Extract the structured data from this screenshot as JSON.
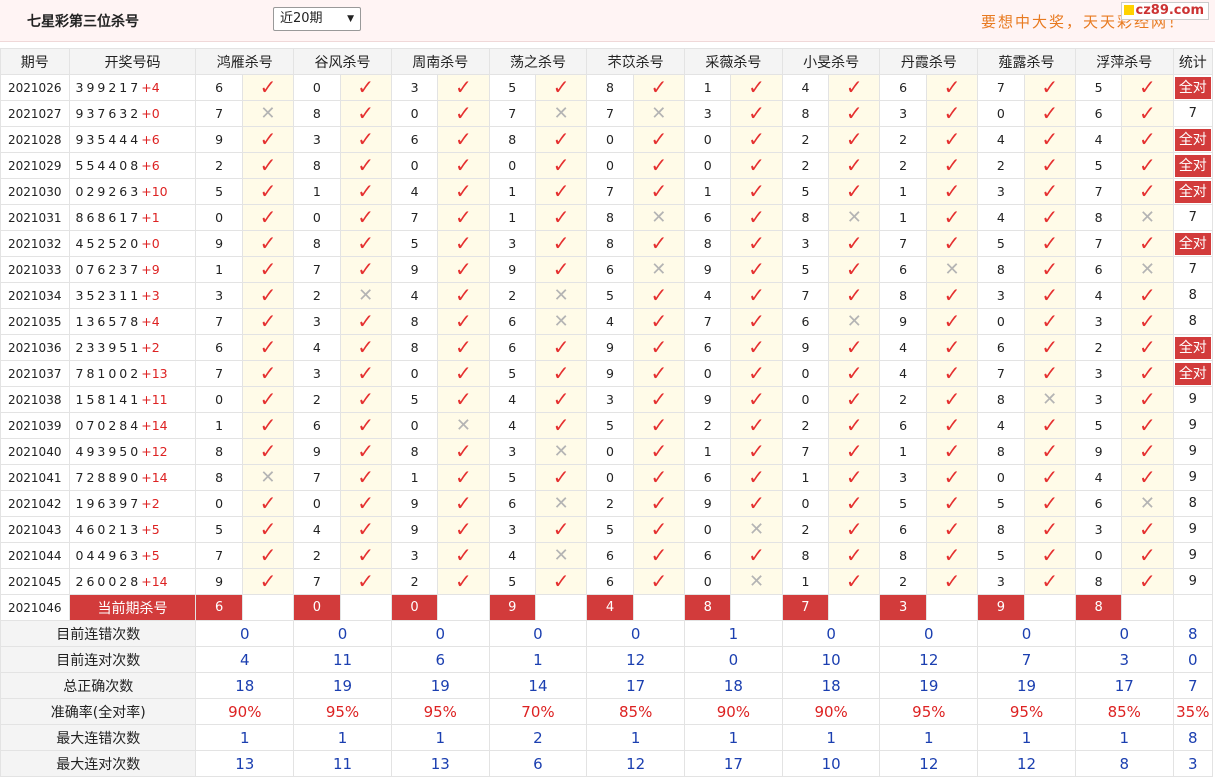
{
  "header": {
    "title": "七星彩第三位杀号",
    "range_select": "近20期",
    "slogan": "要想中大奖，天天彩经网！",
    "logo": "cz89.com"
  },
  "columns": {
    "period": "期号",
    "draw": "开奖号码",
    "experts": [
      "鸿雁杀号",
      "谷风杀号",
      "周南杀号",
      "荡之杀号",
      "芣苡杀号",
      "采薇杀号",
      "小旻杀号",
      "丹霞杀号",
      "薤露杀号",
      "浮萍杀号"
    ],
    "stat": "统计"
  },
  "rows": [
    {
      "period": "2021026",
      "digits": "399217",
      "plus": "+4",
      "kills": [
        6,
        0,
        3,
        5,
        8,
        1,
        4,
        6,
        7,
        5
      ],
      "hits": [
        1,
        1,
        1,
        1,
        1,
        1,
        1,
        1,
        1,
        1
      ],
      "stat": "全对"
    },
    {
      "period": "2021027",
      "digits": "937632",
      "plus": "+0",
      "kills": [
        7,
        8,
        0,
        7,
        7,
        3,
        8,
        3,
        0,
        6
      ],
      "hits": [
        0,
        1,
        1,
        0,
        0,
        1,
        1,
        1,
        1,
        1
      ],
      "stat": "7"
    },
    {
      "period": "2021028",
      "digits": "935444",
      "plus": "+6",
      "kills": [
        9,
        3,
        6,
        8,
        0,
        0,
        2,
        2,
        4,
        4
      ],
      "hits": [
        1,
        1,
        1,
        1,
        1,
        1,
        1,
        1,
        1,
        1
      ],
      "stat": "全对"
    },
    {
      "period": "2021029",
      "digits": "554408",
      "plus": "+6",
      "kills": [
        2,
        8,
        0,
        0,
        0,
        0,
        2,
        2,
        2,
        5
      ],
      "hits": [
        1,
        1,
        1,
        1,
        1,
        1,
        1,
        1,
        1,
        1
      ],
      "stat": "全对"
    },
    {
      "period": "2021030",
      "digits": "029263",
      "plus": "+10",
      "kills": [
        5,
        1,
        4,
        1,
        7,
        1,
        5,
        1,
        3,
        7
      ],
      "hits": [
        1,
        1,
        1,
        1,
        1,
        1,
        1,
        1,
        1,
        1
      ],
      "stat": "全对"
    },
    {
      "period": "2021031",
      "digits": "868617",
      "plus": "+1",
      "kills": [
        0,
        0,
        7,
        1,
        8,
        6,
        8,
        1,
        4,
        8
      ],
      "hits": [
        1,
        1,
        1,
        1,
        0,
        1,
        0,
        1,
        1,
        0
      ],
      "stat": "7"
    },
    {
      "period": "2021032",
      "digits": "452520",
      "plus": "+0",
      "kills": [
        9,
        8,
        5,
        3,
        8,
        8,
        3,
        7,
        5,
        7
      ],
      "hits": [
        1,
        1,
        1,
        1,
        1,
        1,
        1,
        1,
        1,
        1
      ],
      "stat": "全对"
    },
    {
      "period": "2021033",
      "digits": "076237",
      "plus": "+9",
      "kills": [
        1,
        7,
        9,
        9,
        6,
        9,
        5,
        6,
        8,
        6
      ],
      "hits": [
        1,
        1,
        1,
        1,
        0,
        1,
        1,
        0,
        1,
        0
      ],
      "stat": "7"
    },
    {
      "period": "2021034",
      "digits": "352311",
      "plus": "+3",
      "kills": [
        3,
        2,
        4,
        2,
        5,
        4,
        7,
        8,
        3,
        4
      ],
      "hits": [
        1,
        0,
        1,
        0,
        1,
        1,
        1,
        1,
        1,
        1
      ],
      "stat": "8"
    },
    {
      "period": "2021035",
      "digits": "136578",
      "plus": "+4",
      "kills": [
        7,
        3,
        8,
        6,
        4,
        7,
        6,
        9,
        0,
        3
      ],
      "hits": [
        1,
        1,
        1,
        0,
        1,
        1,
        0,
        1,
        1,
        1
      ],
      "stat": "8"
    },
    {
      "period": "2021036",
      "digits": "233951",
      "plus": "+2",
      "kills": [
        6,
        4,
        8,
        6,
        9,
        6,
        9,
        4,
        6,
        2
      ],
      "hits": [
        1,
        1,
        1,
        1,
        1,
        1,
        1,
        1,
        1,
        1
      ],
      "stat": "全对"
    },
    {
      "period": "2021037",
      "digits": "781002",
      "plus": "+13",
      "kills": [
        7,
        3,
        0,
        5,
        9,
        0,
        0,
        4,
        7,
        3
      ],
      "hits": [
        1,
        1,
        1,
        1,
        1,
        1,
        1,
        1,
        1,
        1
      ],
      "stat": "全对"
    },
    {
      "period": "2021038",
      "digits": "158141",
      "plus": "+11",
      "kills": [
        0,
        2,
        5,
        4,
        3,
        9,
        0,
        2,
        8,
        3
      ],
      "hits": [
        1,
        1,
        1,
        1,
        1,
        1,
        1,
        1,
        0,
        1
      ],
      "stat": "9"
    },
    {
      "period": "2021039",
      "digits": "070284",
      "plus": "+14",
      "kills": [
        1,
        6,
        0,
        4,
        5,
        2,
        2,
        6,
        4,
        5
      ],
      "hits": [
        1,
        1,
        0,
        1,
        1,
        1,
        1,
        1,
        1,
        1
      ],
      "stat": "9"
    },
    {
      "period": "2021040",
      "digits": "493950",
      "plus": "+12",
      "kills": [
        8,
        9,
        8,
        3,
        0,
        1,
        7,
        1,
        8,
        9
      ],
      "hits": [
        1,
        1,
        1,
        0,
        1,
        1,
        1,
        1,
        1,
        1
      ],
      "stat": "9"
    },
    {
      "period": "2021041",
      "digits": "728890",
      "plus": "+14",
      "kills": [
        8,
        7,
        1,
        5,
        0,
        6,
        1,
        3,
        0,
        4
      ],
      "hits": [
        0,
        1,
        1,
        1,
        1,
        1,
        1,
        1,
        1,
        1
      ],
      "stat": "9"
    },
    {
      "period": "2021042",
      "digits": "196397",
      "plus": "+2",
      "kills": [
        0,
        0,
        9,
        6,
        2,
        9,
        0,
        5,
        5,
        6
      ],
      "hits": [
        1,
        1,
        1,
        0,
        1,
        1,
        1,
        1,
        1,
        0
      ],
      "stat": "8"
    },
    {
      "period": "2021043",
      "digits": "460213",
      "plus": "+5",
      "kills": [
        5,
        4,
        9,
        3,
        5,
        0,
        2,
        6,
        8,
        3
      ],
      "hits": [
        1,
        1,
        1,
        1,
        1,
        0,
        1,
        1,
        1,
        1
      ],
      "stat": "9"
    },
    {
      "period": "2021044",
      "digits": "044963",
      "plus": "+5",
      "kills": [
        7,
        2,
        3,
        4,
        6,
        6,
        8,
        8,
        5,
        0
      ],
      "hits": [
        1,
        1,
        1,
        0,
        1,
        1,
        1,
        1,
        1,
        1
      ],
      "stat": "9"
    },
    {
      "period": "2021045",
      "digits": "260028",
      "plus": "+14",
      "kills": [
        9,
        7,
        2,
        5,
        6,
        0,
        1,
        2,
        3,
        8
      ],
      "hits": [
        1,
        1,
        1,
        1,
        1,
        0,
        1,
        1,
        1,
        1
      ],
      "stat": "9"
    }
  ],
  "current": {
    "period": "2021046",
    "label": "当前期杀号",
    "kills": [
      6,
      0,
      0,
      9,
      4,
      8,
      7,
      3,
      9,
      8
    ]
  },
  "footer": [
    {
      "label": "目前连错次数",
      "values": [
        "0",
        "0",
        "0",
        "0",
        "0",
        "1",
        "0",
        "0",
        "0",
        "0"
      ],
      "stat": "8",
      "color": "blue"
    },
    {
      "label": "目前连对次数",
      "values": [
        "4",
        "11",
        "6",
        "1",
        "12",
        "0",
        "10",
        "12",
        "7",
        "3"
      ],
      "stat": "0",
      "color": "blue"
    },
    {
      "label": "总正确次数",
      "values": [
        "18",
        "19",
        "19",
        "14",
        "17",
        "18",
        "18",
        "19",
        "19",
        "17"
      ],
      "stat": "7",
      "color": "blue"
    },
    {
      "label": "准确率(全对率)",
      "values": [
        "90%",
        "95%",
        "95%",
        "70%",
        "85%",
        "90%",
        "90%",
        "95%",
        "95%",
        "85%"
      ],
      "stat": "35%",
      "color": "red"
    },
    {
      "label": "最大连错次数",
      "values": [
        "1",
        "1",
        "1",
        "2",
        "1",
        "1",
        "1",
        "1",
        "1",
        "1"
      ],
      "stat": "8",
      "color": "blue"
    },
    {
      "label": "最大连对次数",
      "values": [
        "13",
        "11",
        "13",
        "6",
        "12",
        "17",
        "10",
        "12",
        "12",
        "8"
      ],
      "stat": "3",
      "color": "blue"
    }
  ],
  "icons": {
    "hit": "check-icon",
    "miss": "cross-icon",
    "select": "chevron-down-icon"
  },
  "colors": {
    "check": "#e53030",
    "badge": "#d23b3b",
    "blue": "#1b3fb0",
    "red": "#dd2222",
    "slogan": "#e87a20"
  }
}
